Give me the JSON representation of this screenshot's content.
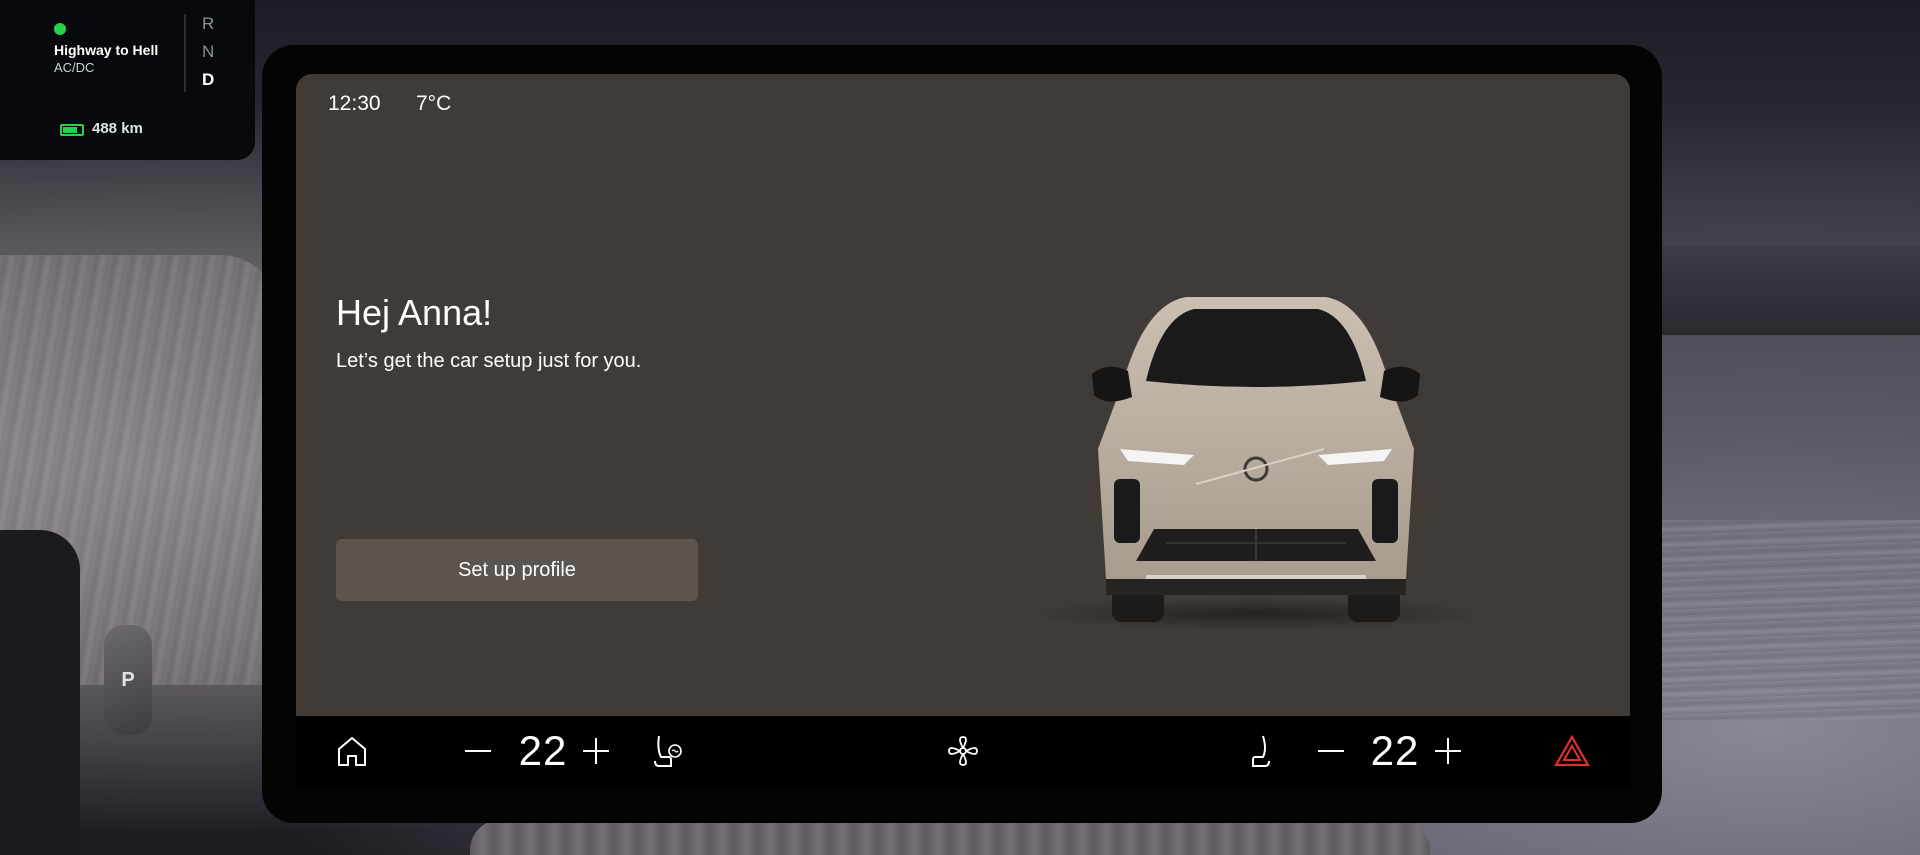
{
  "driver_display": {
    "song": "Highway to Hell",
    "artist": "AC/DC",
    "gears": [
      "R",
      "N",
      "D"
    ],
    "active_gear": "D",
    "range": "488 km",
    "battery_level": 0.7
  },
  "shifter": {
    "label": "P"
  },
  "status_bar": {
    "time": "12:30",
    "temperature": "7°C"
  },
  "welcome": {
    "greeting": "Hej Anna!",
    "subtitle": "Let’s get the car setup just for you.",
    "setup_button": "Set up profile"
  },
  "climate": {
    "driver_temp": "22",
    "passenger_temp": "22",
    "icons": {
      "home": "home-icon",
      "decrease": "minus-icon",
      "increase": "plus-icon",
      "seat_heat": "seat-heating-icon",
      "fan": "fan-icon",
      "passenger_seat": "seat-icon",
      "hazard": "hazard-warning-icon"
    }
  },
  "colors": {
    "screen_bg": "#403b36",
    "button_bg": "#5c544e",
    "hazard": "#e0312b",
    "battery_green": "#27d14a"
  }
}
